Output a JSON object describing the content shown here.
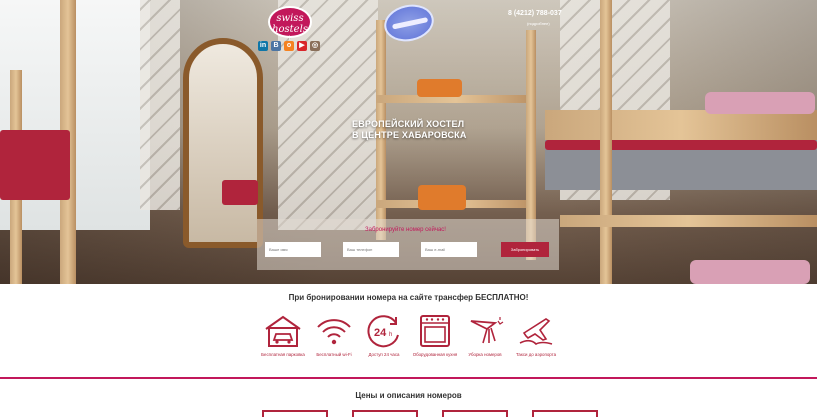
{
  "header": {
    "logo_text_top": "swiss",
    "logo_text_bottom": "hostels",
    "logo_cross": "+",
    "phone": "8 (4212) 788-037",
    "phone_note": "(подробнее)",
    "social": [
      {
        "name": "linkedin-icon",
        "glyph": "in",
        "color": "#0e76a8"
      },
      {
        "name": "vk-icon",
        "glyph": "В",
        "color": "#4c75a3"
      },
      {
        "name": "odnoklassniki-icon",
        "glyph": "о",
        "color": "#f58220"
      },
      {
        "name": "youtube-icon",
        "glyph": "▶",
        "color": "#d9252a"
      },
      {
        "name": "instagram-icon",
        "glyph": "◎",
        "color": "#8a6f5a"
      }
    ]
  },
  "hero": {
    "headline_line1": "ЕВРОПЕЙСКИЙ ХОСТЕЛ",
    "headline_line2": "В ЦЕНТРЕ ХАБАРОВСКА"
  },
  "booking": {
    "title": "Забронируйте номер сейчас!",
    "name_placeholder": "Ваше имя",
    "phone_placeholder": "Ваш телефон",
    "email_placeholder": "Ваш e-mail",
    "submit_label": "Забронировать"
  },
  "transfer_text": "При бронировании номера на сайте трансфер БЕСПЛАТНО!",
  "features": [
    {
      "label": "Бесплатная парковка",
      "icon": "parking-garage-icon"
    },
    {
      "label": "Бесплатный wi-Fi",
      "icon": "wifi-icon"
    },
    {
      "label": "Доступ 24 часа",
      "icon": "24h-icon"
    },
    {
      "label": "Оборудованная кухня",
      "icon": "oven-icon"
    },
    {
      "label": "Уборка номеров",
      "icon": "cleaning-icon"
    },
    {
      "label": "Такси до аэропорта",
      "icon": "airplane-icon"
    }
  ],
  "prices_title": "Цены и описания номеров",
  "colors": {
    "accent": "#b0243c",
    "brand": "#c2185b"
  }
}
